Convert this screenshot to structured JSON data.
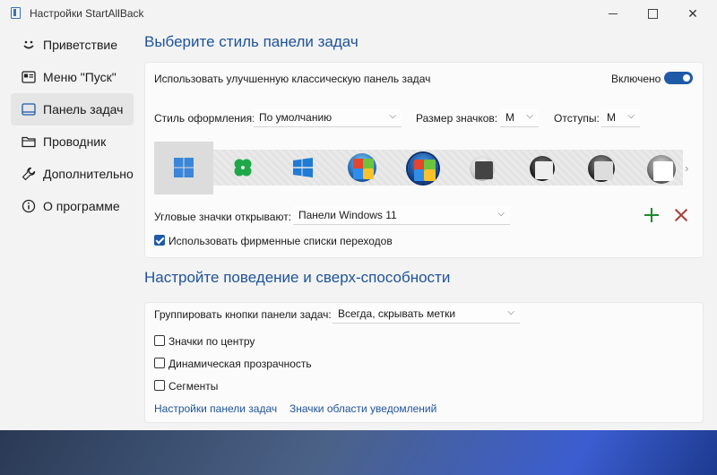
{
  "window": {
    "title": "Настройки StartAllBack"
  },
  "nav": {
    "items": [
      {
        "label": "Приветствие",
        "icon": "smiley-icon"
      },
      {
        "label": "Меню \"Пуск\"",
        "icon": "start-menu-icon"
      },
      {
        "label": "Панель задач",
        "icon": "taskbar-icon",
        "active": true
      },
      {
        "label": "Проводник",
        "icon": "folder-icon"
      },
      {
        "label": "Дополнительно",
        "icon": "wrench-icon"
      },
      {
        "label": "О программе",
        "icon": "info-icon"
      }
    ]
  },
  "section1": {
    "heading": "Выберите стиль панели задач",
    "classic_label": "Использовать улучшенную классическую панель задач",
    "toggle_label": "Включено",
    "toggle_on": true,
    "style_label": "Стиль оформления:",
    "style_value": "По умолчанию",
    "icon_size_label": "Размер значков:",
    "icon_size_value": "M",
    "padding_label": "Отступы:",
    "padding_value": "M",
    "start_buttons": [
      "win11-logo",
      "clover-logo",
      "win10-logo",
      "win7-orb-1",
      "win7-orb-2",
      "vista-orb-1",
      "vista-orb-2",
      "vista-orb-3",
      "vista-orb-4"
    ],
    "corner_label": "Угловые значки открывают:",
    "corner_value": "Панели Windows 11",
    "jumplist_label": "Использовать фирменные списки переходов",
    "jumplist_checked": true
  },
  "section2": {
    "heading": "Настройте поведение и сверх-способности",
    "group_label": "Группировать кнопки панели задач:",
    "group_value": "Всегда, скрывать метки",
    "center_label": "Значки по центру",
    "dynamic_label": "Динамическая прозрачность",
    "segments_label": "Сегменты",
    "link1": "Настройки панели задач",
    "link2": "Значки области уведомлений"
  },
  "colors": {
    "accent": "#1e5aa8",
    "heading": "#1e5399",
    "add": "#1e8a2e",
    "remove": "#a83b36"
  }
}
